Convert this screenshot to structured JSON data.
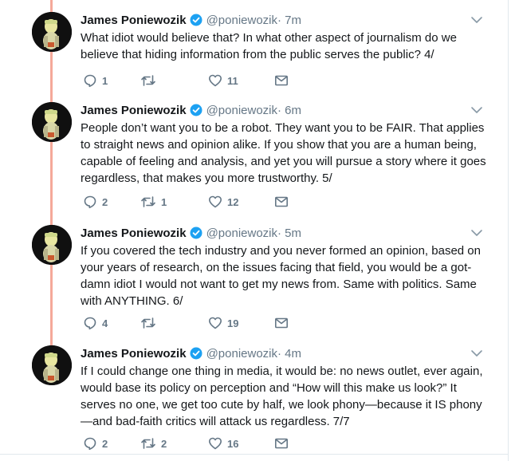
{
  "author": {
    "name": "James Poniewozik",
    "handle": "@poniewozik"
  },
  "tweets": [
    {
      "time": "· 7m",
      "text": "What idiot would believe that? In what other aspect of journalism do we believe that hiding information from the public serves the public? 4/",
      "replies": "1",
      "retweets": "",
      "likes": "11"
    },
    {
      "time": "· 6m",
      "text": "People don’t want you to be a robot. They want you to be FAIR. That applies to straight news and opinion alike. If you show that you are a human being, capable of feeling and analysis, and yet you will pursue a story where it goes regardless, that makes you more trustworthy. 5/",
      "replies": "2",
      "retweets": "1",
      "likes": "12"
    },
    {
      "time": "· 5m",
      "text": "If you covered the tech industry and you never formed an opinion, based on your years of research, on the issues facing that field, you would be a got-damn idiot I would not want to get my news from. Same with politics. Same with ANYTHING. 6/",
      "replies": "4",
      "retweets": "",
      "likes": "19"
    },
    {
      "time": "· 4m",
      "text": "If I could change one thing in media, it would be: no news outlet, ever again, would base its policy on perception and “How will this make us look?” It serves no one, we get too cute by half, we look phony—because it IS phony—and bad-faith critics will attack us regardless. 7/7",
      "replies": "2",
      "retweets": "2",
      "likes": "16"
    }
  ],
  "icons": {
    "reply": "reply-icon",
    "retweet": "retweet-icon",
    "like": "heart-icon",
    "dm": "envelope-icon",
    "verified": "verified-badge-icon",
    "more": "chevron-down-icon"
  },
  "colors": {
    "verified": "#1da1f2",
    "thread_line": "#f5a99a",
    "secondary_text": "#657786",
    "primary_text": "#14171a"
  }
}
